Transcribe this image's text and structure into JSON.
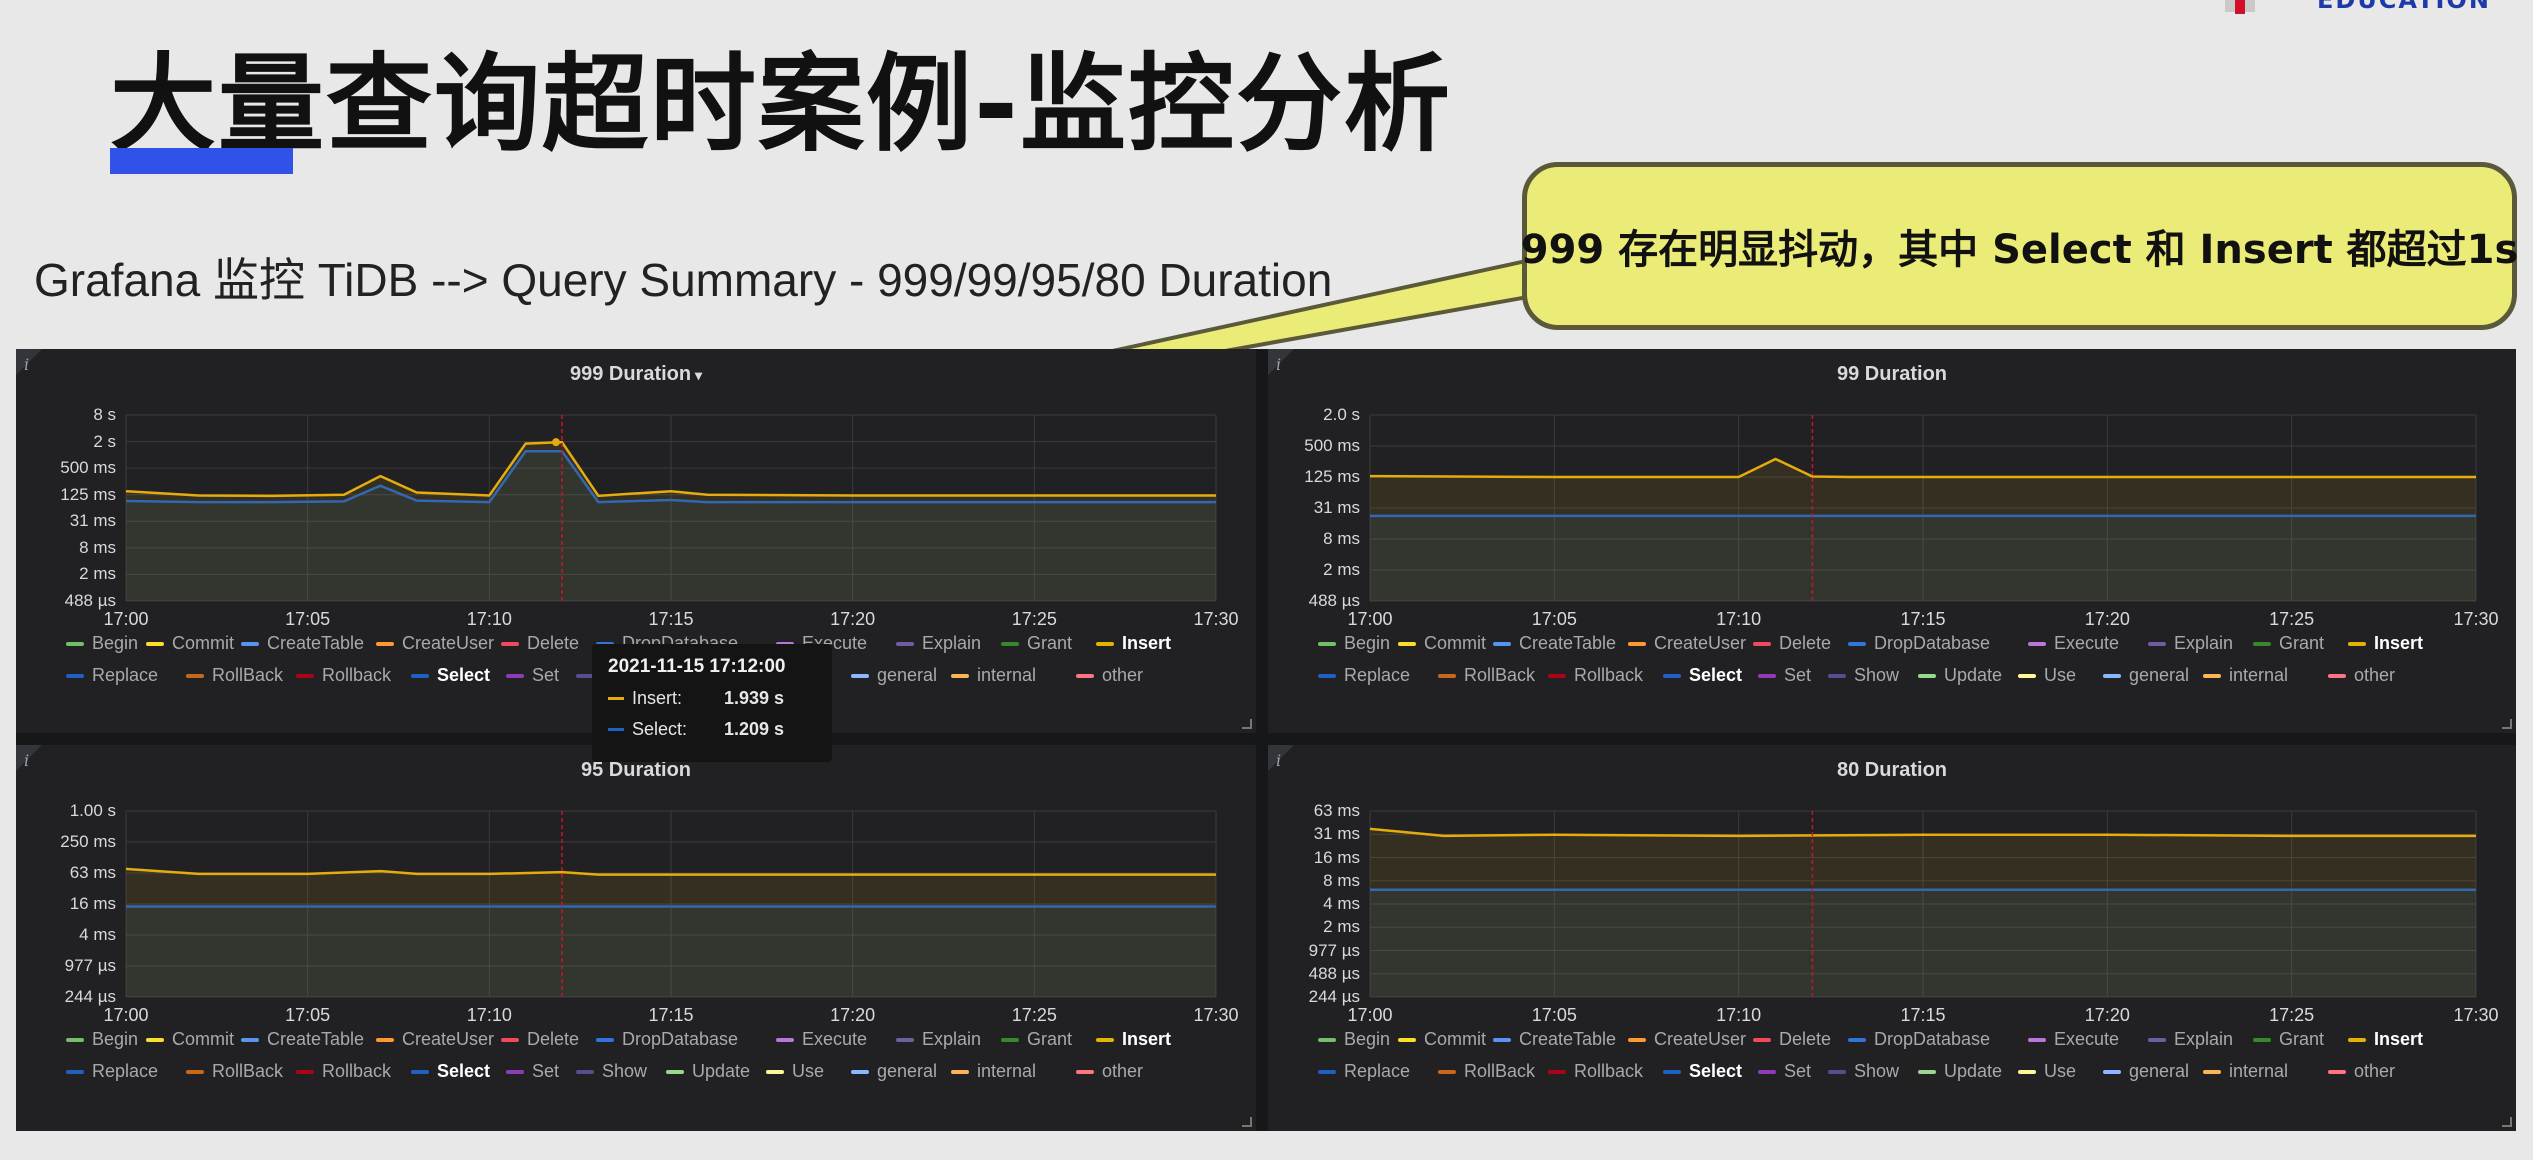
{
  "slide": {
    "title": "大量查询超时案例-监控分析",
    "subtitle": "Grafana 监控 TiDB --> Query Summary - 999/99/95/80 Duration",
    "logo_text": "EDUCATION",
    "callout": "999 存在明显抖动，其中 Select 和 Insert 都超过1s"
  },
  "colors": {
    "insert": "#e5ac0e",
    "select": "#1f60c4",
    "cursor": "#c4162a",
    "grid": "#3a3b3e"
  },
  "legend": {
    "row1": [
      {
        "name": "Begin",
        "color": "#73bf69"
      },
      {
        "name": "Commit",
        "color": "#fade2a"
      },
      {
        "name": "CreateTable",
        "color": "#5794f2"
      },
      {
        "name": "CreateUser",
        "color": "#ff9830"
      },
      {
        "name": "Delete",
        "color": "#f2495c"
      },
      {
        "name": "DropDatabase",
        "color": "#3274d9"
      },
      {
        "name": "Execute",
        "color": "#b877d9"
      },
      {
        "name": "Explain",
        "color": "#705da0"
      },
      {
        "name": "Grant",
        "color": "#37872d"
      },
      {
        "name": "Insert",
        "color": "#e0b400",
        "selected": true
      }
    ],
    "row2": [
      {
        "name": "Replace",
        "color": "#1f60c4"
      },
      {
        "name": "RollBack",
        "color": "#c8681b"
      },
      {
        "name": "Rollback",
        "color": "#ad0317"
      },
      {
        "name": "Select",
        "color": "#1f60c4",
        "selected": true
      },
      {
        "name": "Set",
        "color": "#8f3bb8"
      },
      {
        "name": "Show",
        "color": "#5a4c8e"
      },
      {
        "name": "Update",
        "color": "#96d98d"
      },
      {
        "name": "Use",
        "color": "#fff899"
      },
      {
        "name": "general",
        "color": "#8ab8ff"
      },
      {
        "name": "internal",
        "color": "#ffb357"
      },
      {
        "name": "other",
        "color": "#ff7383"
      }
    ]
  },
  "panels": [
    {
      "id": "p999",
      "title": "999 Duration",
      "has_dropdown": true,
      "yticks": [
        "8 s",
        "2 s",
        "500 ms",
        "125 ms",
        "31 ms",
        "8 ms",
        "2 ms",
        "488 µs"
      ],
      "xticks": [
        "17:00",
        "17:05",
        "17:10",
        "17:15",
        "17:20",
        "17:25",
        "17:30"
      ]
    },
    {
      "id": "p99",
      "title": "99 Duration",
      "has_dropdown": false,
      "yticks": [
        "2.0 s",
        "500 ms",
        "125 ms",
        "31 ms",
        "8 ms",
        "2 ms",
        "488 µs"
      ],
      "xticks": [
        "17:00",
        "17:05",
        "17:10",
        "17:15",
        "17:20",
        "17:25",
        "17:30"
      ]
    },
    {
      "id": "p95",
      "title": "95 Duration",
      "has_dropdown": false,
      "yticks": [
        "1.00 s",
        "250 ms",
        "63 ms",
        "16 ms",
        "4 ms",
        "977 µs",
        "244 µs"
      ],
      "xticks": [
        "17:00",
        "17:05",
        "17:10",
        "17:15",
        "17:20",
        "17:25",
        "17:30"
      ]
    },
    {
      "id": "p80",
      "title": "80 Duration",
      "has_dropdown": false,
      "yticks": [
        "63 ms",
        "31 ms",
        "16 ms",
        "8 ms",
        "4 ms",
        "2 ms",
        "977 µs",
        "488 µs",
        "244 µs"
      ],
      "xticks": [
        "17:00",
        "17:05",
        "17:10",
        "17:15",
        "17:20",
        "17:25",
        "17:30"
      ]
    }
  ],
  "tooltip": {
    "time": "2021-11-15 17:12:00",
    "rows": [
      {
        "label": "Insert:",
        "value": "1.939 s",
        "color": "#e5ac0e"
      },
      {
        "label": "Select:",
        "value": "1.209 s",
        "color": "#1f60c4"
      }
    ]
  },
  "chart_data": [
    {
      "type": "line",
      "title": "999 Duration",
      "y_scale": "log",
      "x": [
        "17:00",
        "17:02",
        "17:04",
        "17:06",
        "17:07",
        "17:08",
        "17:10",
        "17:11",
        "17:12",
        "17:13",
        "17:15",
        "17:16",
        "17:20",
        "17:25",
        "17:30"
      ],
      "series": [
        {
          "name": "Insert",
          "values": [
            150,
            120,
            118,
            125,
            330,
            140,
            120,
            1800,
            1939,
            118,
            150,
            125,
            120,
            120,
            120
          ]
        },
        {
          "name": "Select",
          "values": [
            90,
            85,
            85,
            88,
            200,
            92,
            85,
            1209,
            1209,
            85,
            95,
            85,
            85,
            85,
            85
          ]
        }
      ],
      "cursor": "17:12"
    },
    {
      "type": "line",
      "title": "99 Duration",
      "y_scale": "log",
      "x": [
        "17:00",
        "17:05",
        "17:10",
        "17:11",
        "17:12",
        "17:13",
        "17:20",
        "17:25",
        "17:30"
      ],
      "series": [
        {
          "name": "Insert",
          "values": [
            130,
            125,
            125,
            280,
            128,
            125,
            125,
            125,
            125
          ]
        },
        {
          "name": "Select",
          "values": [
            22,
            22,
            22,
            22,
            22,
            22,
            22,
            22,
            22
          ]
        }
      ],
      "cursor": "17:12"
    },
    {
      "type": "line",
      "title": "95 Duration",
      "y_scale": "log",
      "x": [
        "17:00",
        "17:02",
        "17:05",
        "17:07",
        "17:08",
        "17:10",
        "17:12",
        "17:13",
        "17:20",
        "17:25",
        "17:30"
      ],
      "series": [
        {
          "name": "Insert",
          "values": [
            75,
            60,
            60,
            68,
            60,
            60,
            65,
            58,
            58,
            58,
            58
          ]
        },
        {
          "name": "Select",
          "values": [
            14,
            14,
            14,
            14,
            14,
            14,
            14,
            14,
            14,
            14,
            14
          ]
        }
      ],
      "cursor": "17:12"
    },
    {
      "type": "line",
      "title": "80 Duration",
      "y_scale": "log",
      "x": [
        "17:00",
        "17:02",
        "17:05",
        "17:10",
        "17:15",
        "17:20",
        "17:25",
        "17:30"
      ],
      "series": [
        {
          "name": "Insert",
          "values": [
            37,
            30,
            31,
            30,
            31,
            31,
            30,
            30
          ]
        },
        {
          "name": "Select",
          "values": [
            6,
            6,
            6,
            6,
            6,
            6,
            6,
            6
          ]
        }
      ],
      "cursor": "17:12"
    }
  ]
}
